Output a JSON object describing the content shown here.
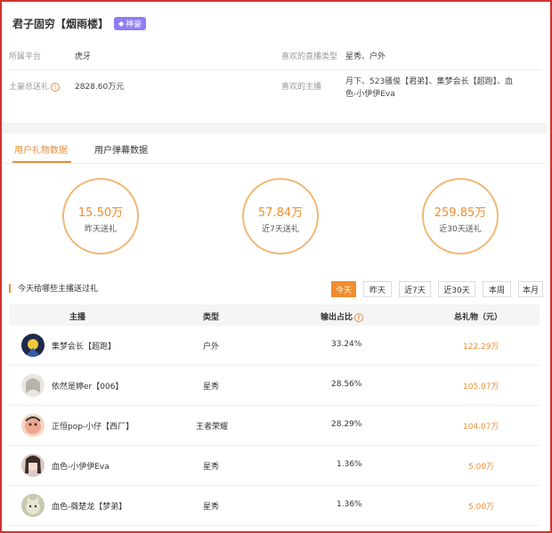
{
  "profile": {
    "name": "君子固穷【烟雨楼】",
    "badge": "神豪",
    "platform_label": "所属平台",
    "platform_value": "虎牙",
    "fav_type_label": "喜欢的直播类型",
    "fav_type_value": "星秀、户外",
    "total_label": "土豪总送礼",
    "total_value": "2828.60万元",
    "fav_anchor_label": "喜欢的主播",
    "fav_anchor_line1": "月下、523骚俊【君弟】、集梦会长【超跑】、血",
    "fav_anchor_line2": "色-小伊伊Eva"
  },
  "tabs": [
    "用户礼物数据",
    "用户弹幕数据"
  ],
  "stats": [
    {
      "value": "15.50万",
      "caption": "昨天送礼"
    },
    {
      "value": "57.84万",
      "caption": "近7天送礼"
    },
    {
      "value": "259.85万",
      "caption": "近30天送礼"
    }
  ],
  "section_title": "今天给哪些主播送过礼",
  "filters": [
    "今天",
    "昨天",
    "近7天",
    "近30天",
    "本周",
    "本月"
  ],
  "active_filter": "今天",
  "table": {
    "headers": [
      "主播",
      "类型",
      "输出占比",
      "总礼物（元）"
    ],
    "rows": [
      {
        "anchor": "集梦会长【超跑】",
        "type": "户外",
        "share": "33.24%",
        "gift": "122.29万",
        "avatar": "avatar-dark"
      },
      {
        "anchor": "依然是婷er【006】",
        "type": "星秀",
        "share": "28.56%",
        "gift": "105.07万",
        "avatar": "avatar-girl-anime"
      },
      {
        "anchor": "正恒pop-小仔【西厂】",
        "type": "王者荣耀",
        "share": "28.29%",
        "gift": "104.07万",
        "avatar": "avatar-cartoon"
      },
      {
        "anchor": "血色-小伊伊Eva",
        "type": "星秀",
        "share": "1.36%",
        "gift": "5.00万",
        "avatar": "avatar-girl"
      },
      {
        "anchor": "血色-薇楚龙【梦弟】",
        "type": "星秀",
        "share": "1.36%",
        "gift": "5.00万",
        "avatar": "avatar-cat"
      }
    ]
  },
  "colors": {
    "accent": "#f08c2c",
    "frame": "#d0322d",
    "badge": "#8f7df2"
  }
}
